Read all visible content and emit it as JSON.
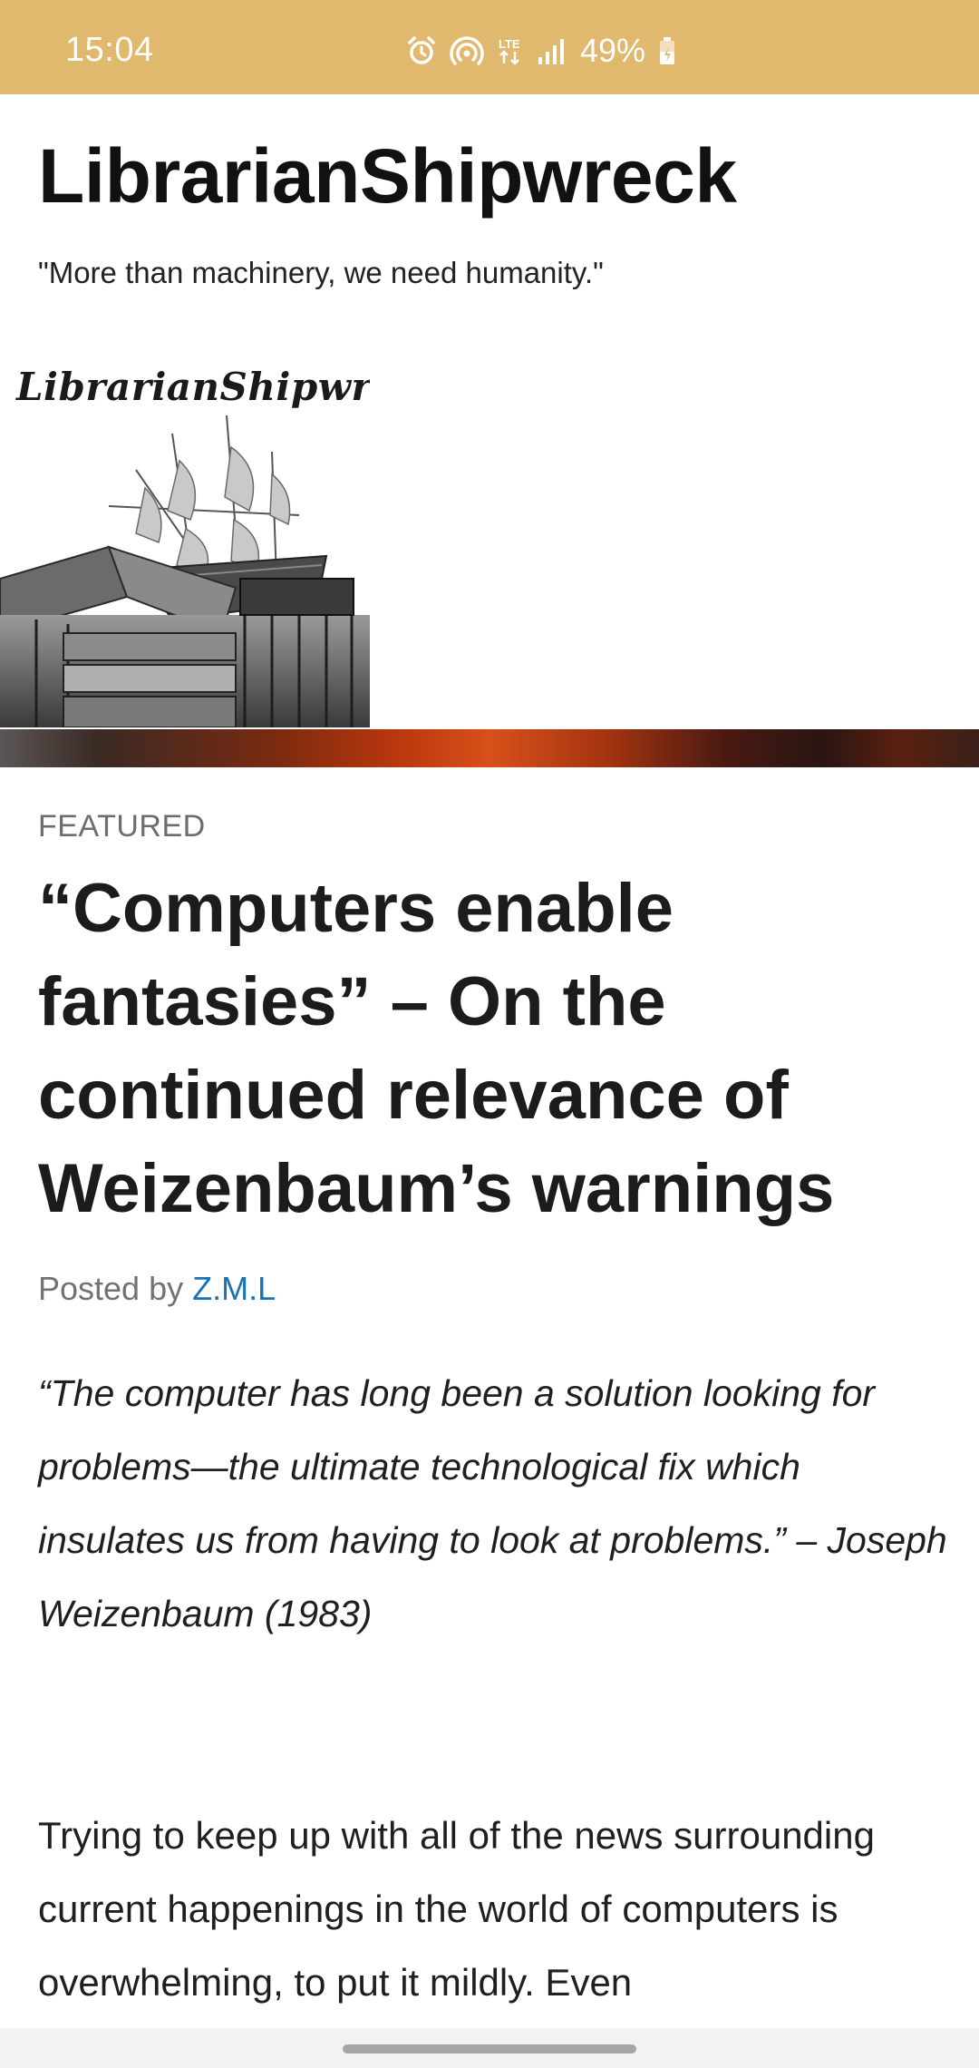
{
  "status_bar": {
    "time": "15:04",
    "network": "LTE",
    "battery": "49%",
    "icons": [
      "alarm-icon",
      "hotspot-icon",
      "lte-icon",
      "signal-icon",
      "battery-icon"
    ],
    "background_color": "#e0b86e"
  },
  "site": {
    "title": "LibrarianShipwreck",
    "tagline": "\"More than machinery, we need humanity.\"",
    "header_image_text": "LibrarianShipwreck"
  },
  "post": {
    "category": "FEATURED",
    "title": "“Computers enable fantasies” – On the continued relevance of Weizenbaum’s warnings",
    "byline_prefix": "Posted by",
    "author": "Z.M.L",
    "quote": "“The computer has long been a solution looking for problems—the ultimate technological fix which insulates us from having to look at problems.” – Joseph Weizenbaum (1983)",
    "body": "Trying to keep up with all of the news surrounding current happenings in the world of computers is overwhelming, to put it mildly. Even"
  },
  "colors": {
    "author_link": "#1a73b5",
    "category_label": "#6d6d6d"
  }
}
